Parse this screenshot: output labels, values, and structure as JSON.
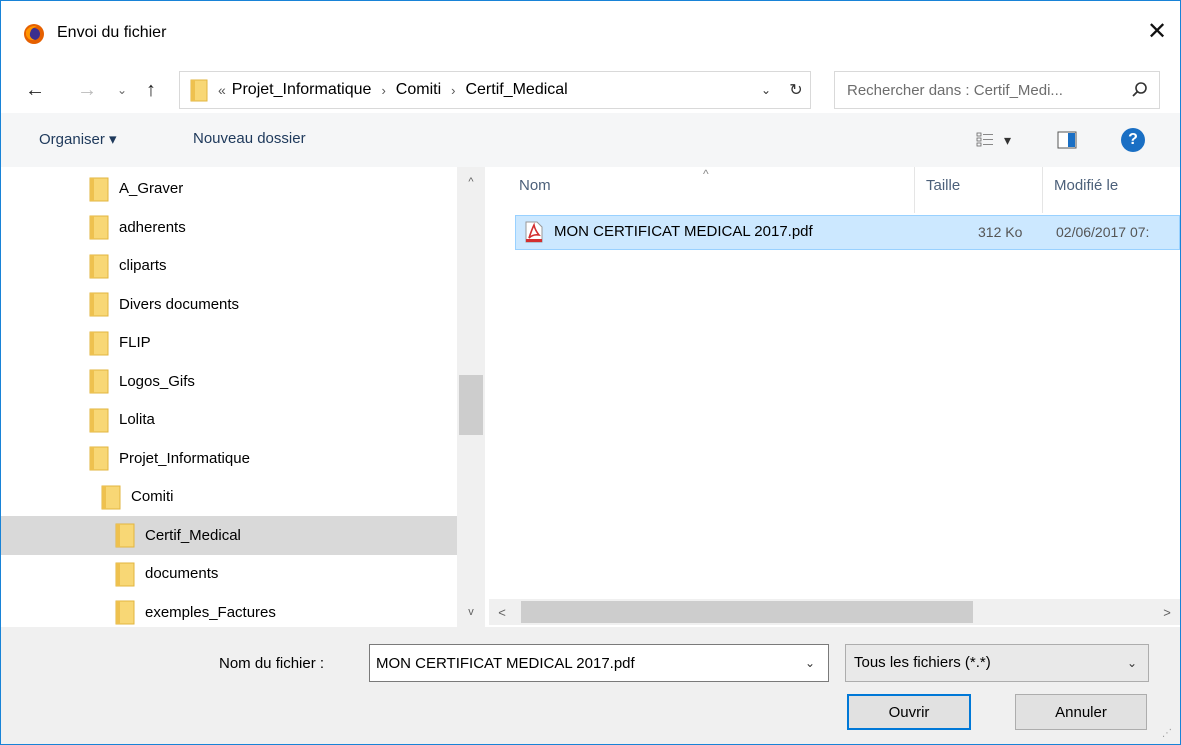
{
  "window": {
    "title": "Envoi du fichier",
    "close_glyph": "✕",
    "app_icon": "firefox-icon"
  },
  "nav": {
    "back_glyph": "←",
    "forward_glyph": "→",
    "recent_glyph": "⌄",
    "up_glyph": "↑",
    "overflow_glyph": "«",
    "breadcrumb": [
      "Projet_Informatique",
      "Comiti",
      "Certif_Medical"
    ],
    "separator_glyph": "›",
    "dropdown_glyph": "⌄",
    "refresh_glyph": "↻"
  },
  "search": {
    "placeholder": "Rechercher dans : Certif_Medi...",
    "icon": "search-icon"
  },
  "toolbar": {
    "organise_label": "Organiser ▾",
    "new_folder_label": "Nouveau dossier",
    "view_dropdown_glyph": "▾",
    "help_glyph": "?"
  },
  "tree": {
    "items": [
      {
        "label": "A_Graver",
        "indent": 0,
        "selected": false
      },
      {
        "label": "adherents",
        "indent": 0,
        "selected": false
      },
      {
        "label": "cliparts",
        "indent": 0,
        "selected": false
      },
      {
        "label": "Divers documents",
        "indent": 0,
        "selected": false
      },
      {
        "label": "FLIP",
        "indent": 0,
        "selected": false
      },
      {
        "label": "Logos_Gifs",
        "indent": 0,
        "selected": false
      },
      {
        "label": "Lolita",
        "indent": 0,
        "selected": false
      },
      {
        "label": "Projet_Informatique",
        "indent": 0,
        "selected": false
      },
      {
        "label": "Comiti",
        "indent": 1,
        "selected": false
      },
      {
        "label": "Certif_Medical",
        "indent": 2,
        "selected": true
      },
      {
        "label": "documents",
        "indent": 2,
        "selected": false
      },
      {
        "label": "exemples_Factures",
        "indent": 2,
        "selected": false
      }
    ],
    "scroll_up_glyph": "^",
    "scroll_down_glyph": "v"
  },
  "filelist": {
    "columns": {
      "name": "Nom",
      "size": "Taille",
      "modified": "Modifié le"
    },
    "sort_glyph": "^",
    "files": [
      {
        "name": "MON CERTIFICAT MEDICAL 2017.pdf",
        "size": "312 Ko",
        "modified": "02/06/2017 07:",
        "icon": "pdf-icon"
      }
    ],
    "scroll_left_glyph": "<",
    "scroll_right_glyph": ">"
  },
  "bottom": {
    "filename_label": "Nom du fichier :",
    "filename_value": "MON CERTIFICAT MEDICAL 2017.pdf",
    "filename_drop_glyph": "⌄",
    "filetype_value": "Tous les fichiers (*.*)",
    "filetype_drop_glyph": "⌄",
    "open_label": "Ouvrir",
    "cancel_label": "Annuler"
  },
  "colors": {
    "accent": "#0078d7",
    "selection_bg": "#cce8ff",
    "tree_selected_bg": "#d9d9d9",
    "folder": "#f8d775",
    "toolbar_text": "#1e395b"
  }
}
